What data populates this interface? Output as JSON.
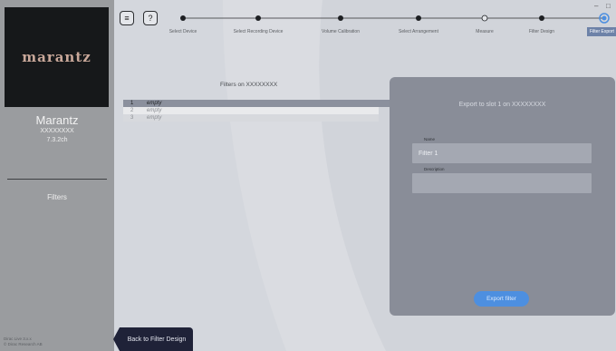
{
  "sidebar": {
    "logo": "marantz",
    "brand": "Marantz",
    "model": "XXXXXXXX",
    "config": "7.3.2ch",
    "nav_item": "Filters",
    "footer_line1": "Dirac Live 3.x.x",
    "footer_line2": "© Dirac Research AB"
  },
  "window": {
    "minimize": "–",
    "maximize": "□"
  },
  "top_buttons": {
    "menu_icon": "≡",
    "help_label": "?"
  },
  "steps": [
    {
      "label": "Select Device",
      "state": "done"
    },
    {
      "label": "Select Recording Device",
      "state": "done"
    },
    {
      "label": "Volume Calibration",
      "state": "done"
    },
    {
      "label": "Select Arrangement",
      "state": "done"
    },
    {
      "label": "Measure",
      "state": "pending"
    },
    {
      "label": "Filter Design",
      "state": "done"
    },
    {
      "label": "Filter Export",
      "state": "active"
    }
  ],
  "filters": {
    "title": "Filters on XXXXXXXX",
    "rows": [
      {
        "num": "1",
        "name": "empty"
      },
      {
        "num": "2",
        "name": "empty"
      },
      {
        "num": "3",
        "name": "empty"
      }
    ]
  },
  "export": {
    "title": "Export to slot 1 on XXXXXXXX",
    "name_label": "Name",
    "name_value": "Filter 1",
    "description_label": "Description",
    "description_value": "",
    "button": "Export filter"
  },
  "back_button": "Back to Filter Design",
  "colors": {
    "accent": "#4d8fe0",
    "active_step": "#6d82a8",
    "panel": "#898d98",
    "sidebar": "#9a9c9f"
  }
}
